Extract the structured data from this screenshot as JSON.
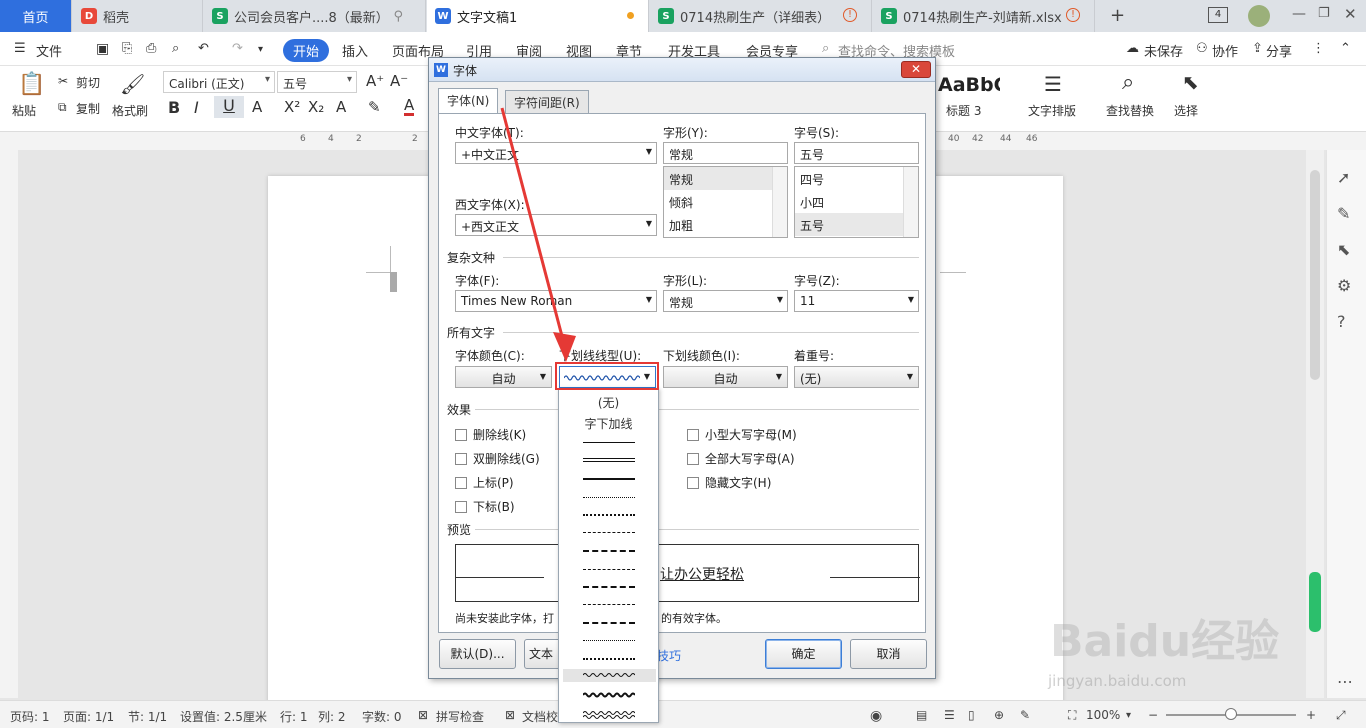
{
  "tabs": [
    {
      "label": "首页"
    },
    {
      "label": "稻壳",
      "icon": "docer-icon"
    },
    {
      "label": "公司会员客户....8（最新）",
      "icon": "sheet-icon"
    },
    {
      "label": "文字文稿1",
      "icon": "writer-icon"
    },
    {
      "label": "0714热刷生产（详细表）",
      "icon": "sheet-icon"
    },
    {
      "label": "0714热刷生产-刘靖新.xlsx",
      "icon": "sheet-icon"
    }
  ],
  "tab_badge": "4",
  "menu": {
    "file": "文件",
    "items": [
      "开始",
      "插入",
      "页面布局",
      "引用",
      "审阅",
      "视图",
      "章节",
      "开发工具",
      "会员专享"
    ],
    "search": "查找命令、搜索模板",
    "unsaved": "未保存",
    "collab": "协作",
    "share": "分享"
  },
  "ribbon": {
    "paste": "粘贴",
    "cut": "剪切",
    "copy": "复制",
    "format_painter": "格式刷",
    "font": "Calibri (正文)",
    "size": "五号",
    "style_preview": "AaBbC",
    "style_name": "标题 3",
    "text_layout": "文字排版",
    "find_replace": "查找替换",
    "select": "选择"
  },
  "ruler_top": [
    "6",
    "4",
    "2",
    "2",
    "40",
    "42",
    "44",
    "46"
  ],
  "dialog": {
    "title": "字体",
    "tab_font": "字体(N)",
    "tab_spacing": "字符间距(R)",
    "cn_font_label": "中文字体(T):",
    "cn_font": "+中文正文",
    "style_label": "字形(Y):",
    "style_value": "常规",
    "style_list": [
      "常规",
      "倾斜",
      "加粗"
    ],
    "size_label": "字号(S):",
    "size_value": "五号",
    "size_list": [
      "四号",
      "小四",
      "五号"
    ],
    "west_font_label": "西文字体(X):",
    "west_font": "+西文正文",
    "complex_section": "复杂文种",
    "complex_font_label": "字体(F):",
    "complex_font": "Times New Roman",
    "complex_style_label": "字形(L):",
    "complex_style": "常规",
    "complex_size_label": "字号(Z):",
    "complex_size": "11",
    "all_text_section": "所有文字",
    "color_label": "字体颜色(C):",
    "color_value": "自动",
    "underline_type_label": "下划线线型(U):",
    "underline_color_label": "下划线颜色(I):",
    "underline_color": "自动",
    "emphasis_label": "着重号:",
    "emphasis_value": "(无)",
    "effects_section": "效果",
    "effects": [
      "删除线(K)",
      "双删除线(G)",
      "上标(P)",
      "下标(B)",
      "小型大写字母(M)",
      "全部大写字母(A)",
      "隐藏文字(H)"
    ],
    "preview_section": "预览",
    "preview_text": "让办公更轻松",
    "note": "尚未安装此字体，打",
    "note2": "的有效字体。",
    "btn_default": "默认(D)...",
    "btn_text": "文本效",
    "btn_tips": "技巧",
    "btn_ok": "确定",
    "btn_cancel": "取消"
  },
  "dropdown": {
    "none": "(无)",
    "word_only": "字下加线"
  },
  "status": {
    "page": "页码: 1",
    "pages": "页面: 1/1",
    "section": "节: 1/1",
    "setting": "设置值: 2.5厘米",
    "row": "行: 1",
    "col": "列: 2",
    "words": "字数: 0",
    "spell": "拼写检查",
    "doccheck": "文档校",
    "zoom": "100%"
  },
  "watermark": "Baidu经验",
  "watermark_url": "jingyan.baidu.com",
  "colors": {
    "accent": "#2f6fde",
    "highlight": "#e53935"
  }
}
